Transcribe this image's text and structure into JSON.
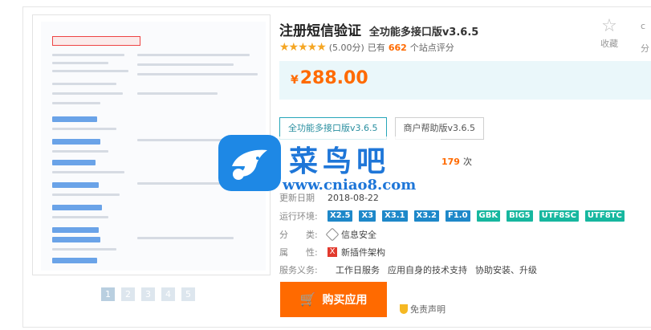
{
  "product": {
    "title": "注册短信验证",
    "subtitle": "全功能多接口版v3.6.5",
    "rating_text": "(5.00分)",
    "rating_prefix": "已有",
    "rating_count": "662",
    "rating_suffix": "个站点评分",
    "stars": 5
  },
  "actions": {
    "favorite_label": "收藏",
    "share_label": "分",
    "share_top": "c"
  },
  "price": {
    "symbol": "¥",
    "value": "288.00"
  },
  "versions": [
    {
      "label": "全功能多接口版v3.6.5",
      "active": true
    },
    {
      "label": "商户帮助版v3.6.5",
      "active": false
    }
  ],
  "details": {
    "installs_value": "179",
    "installs_suffix": "次",
    "update_label": "更新日期",
    "update_value": "2018-08-22",
    "env_label": "运行环境:",
    "env_tags": [
      {
        "text": "X2.5",
        "color": "#1e88c9"
      },
      {
        "text": "X3",
        "color": "#1e88c9"
      },
      {
        "text": "X3.1",
        "color": "#1e88c9"
      },
      {
        "text": "X3.2",
        "color": "#1e88c9"
      },
      {
        "text": "F1.0",
        "color": "#1e88c9"
      },
      {
        "text": "GBK",
        "color": "#17b79f"
      },
      {
        "text": "BIG5",
        "color": "#17b79f"
      },
      {
        "text": "UTF8SC",
        "color": "#17b79f"
      },
      {
        "text": "UTF8TC",
        "color": "#17b79f"
      }
    ],
    "category_label": "分　　类:",
    "category_value": "信息安全",
    "property_label": "属　　性:",
    "property_value": "新插件架构",
    "service_label": "服务义务:",
    "services": [
      "工作日服务",
      "应用自身的技术支持",
      "协助安装、升级"
    ]
  },
  "buttons": {
    "buy_label": "购买应用",
    "disclaimer_label": "免责声明"
  },
  "thumbnails": [
    "1",
    "2",
    "3",
    "4",
    "5"
  ],
  "watermark": {
    "brand": "菜鸟吧",
    "url": "www.cniao8.com"
  },
  "colors": {
    "accent": "#ff6a00",
    "price_bg": "#eaf7fa",
    "version_active": "#27a6b9",
    "watermark_blue": "#1e76d8"
  }
}
